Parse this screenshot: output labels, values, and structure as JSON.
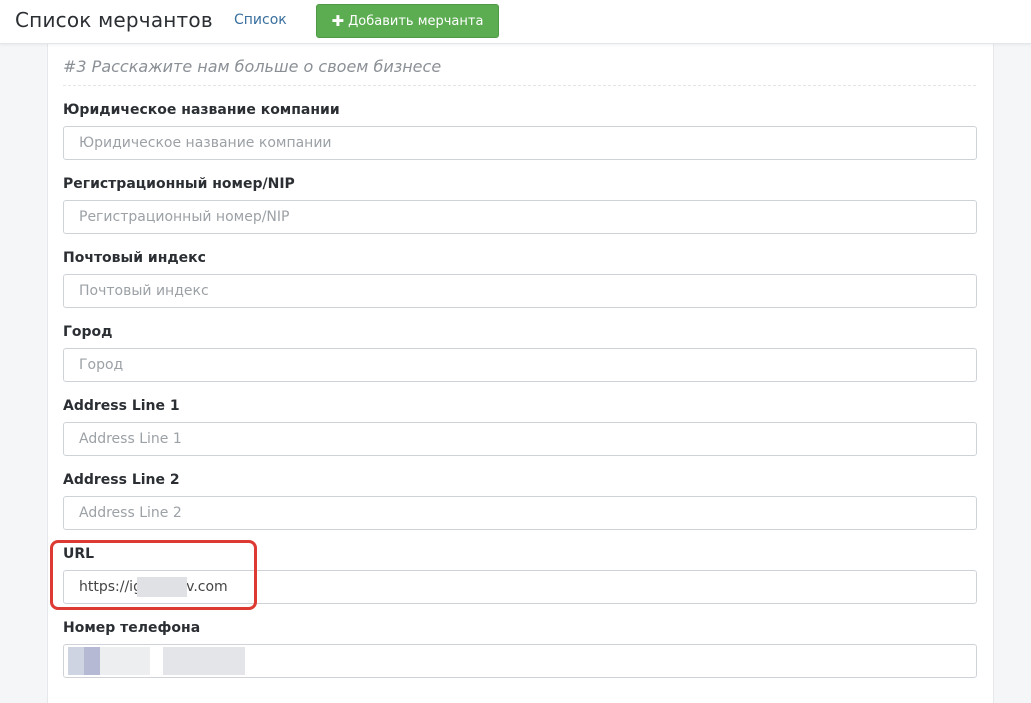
{
  "header": {
    "title": "Список мерчантов",
    "nav_link": "Список",
    "add_button": "Добавить мерчанта",
    "add_icon": "plus-icon"
  },
  "form": {
    "section_title": "#3 Расскажите нам больше о своем бизнесе",
    "fields": [
      {
        "label": "Юридическое название компании",
        "value": "",
        "placeholder": "Юридическое название компании"
      },
      {
        "label": "Регистрационный номер/NIP",
        "value": "",
        "placeholder": "Регистрационный номер/NIP"
      },
      {
        "label": "Почтовый индекс",
        "value": "",
        "placeholder": "Почтовый индекс"
      },
      {
        "label": "Город",
        "value": "",
        "placeholder": "Город"
      },
      {
        "label": "Address Line 1",
        "value": "",
        "placeholder": "Address Line 1"
      },
      {
        "label": "Address Line 2",
        "value": "",
        "placeholder": "Address Line 2"
      },
      {
        "label": "URL",
        "value": "https://ig        ov.com",
        "placeholder": ""
      },
      {
        "label": "Номер телефона",
        "value": "",
        "placeholder": ""
      }
    ]
  },
  "colors": {
    "accent_button": "#5cac52",
    "highlight_border": "#dd3a33",
    "link": "#3b6f9e"
  }
}
